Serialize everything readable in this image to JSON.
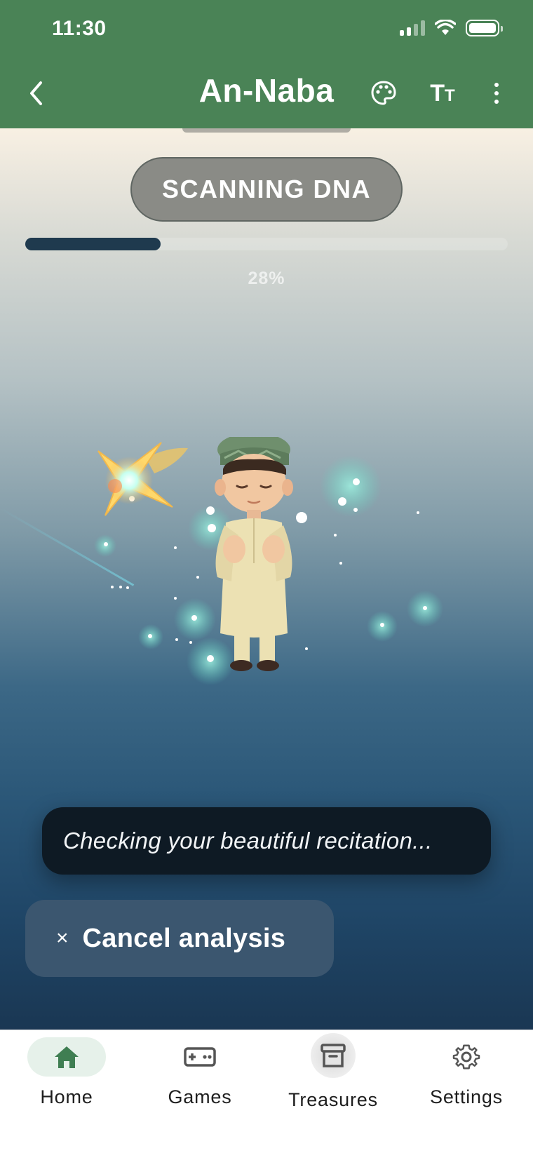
{
  "status_bar": {
    "time": "11:30"
  },
  "header": {
    "title": "An-Naba",
    "text_size_glyph_big": "T",
    "text_size_glyph_small": "T"
  },
  "scan": {
    "label": "SCANNING DNA",
    "progress_text": "28%",
    "progress_fraction": 0.28
  },
  "message": {
    "text": "Checking your beautiful recitation..."
  },
  "cancel": {
    "icon": "×",
    "label": "Cancel analysis"
  },
  "nav": {
    "items": [
      {
        "label": "Home",
        "icon": "home-icon",
        "active": true
      },
      {
        "label": "Games",
        "icon": "gamepad-icon"
      },
      {
        "label": "Treasures",
        "icon": "archive-box-icon"
      },
      {
        "label": "Settings",
        "icon": "gear-icon"
      }
    ]
  },
  "colors": {
    "header": "#4a8356",
    "progress": "#1f3a4e",
    "accent_green": "#3f7e52",
    "cancel_bg": "#3b566f"
  }
}
